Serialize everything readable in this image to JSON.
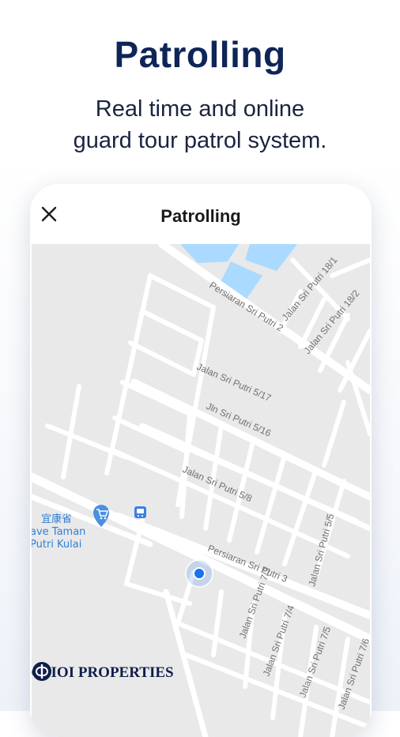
{
  "promo": {
    "headline": "Patrolling",
    "subtitle_line1": "Real time and online",
    "subtitle_line2": "guard tour patrol system."
  },
  "screen": {
    "title": "Patrolling",
    "close_icon": "close-icon"
  },
  "map": {
    "streets": [
      "Persiaran Sri Putri 2",
      "Jalan Sri Putri 18/1",
      "Jalan Sri Putri 18/2",
      "Jalan Sri Putri 5/17",
      "Jln Sri Putri 5/16",
      "Jalan Sri Putri 5/8",
      "Persiaran Sri Putri 3",
      "Jalan Sri Putri 5/5",
      "Jalan Sri Putri 7/3",
      "Jalan Sri Putri 7/4",
      "Jalan Sri Putri 7/5",
      "Jalan Sri Putri 7/6"
    ],
    "poi": {
      "name_cn": "宜康省",
      "name_line2": "ave Taman",
      "name_line3": "Putri Kulai",
      "icon": "shopping-cart-icon"
    },
    "transit_icon": "bus-stop-icon",
    "location_icon": "current-location-icon",
    "colors": {
      "land": "#e9e9e9",
      "road": "#ffffff",
      "water": "#aadaff",
      "location": "#1a73e8"
    }
  },
  "watermark": {
    "copyright": "©",
    "brand": "IOI PROPERTIES"
  },
  "colors": {
    "headline": "#0f2557",
    "text": "#1a2440"
  }
}
